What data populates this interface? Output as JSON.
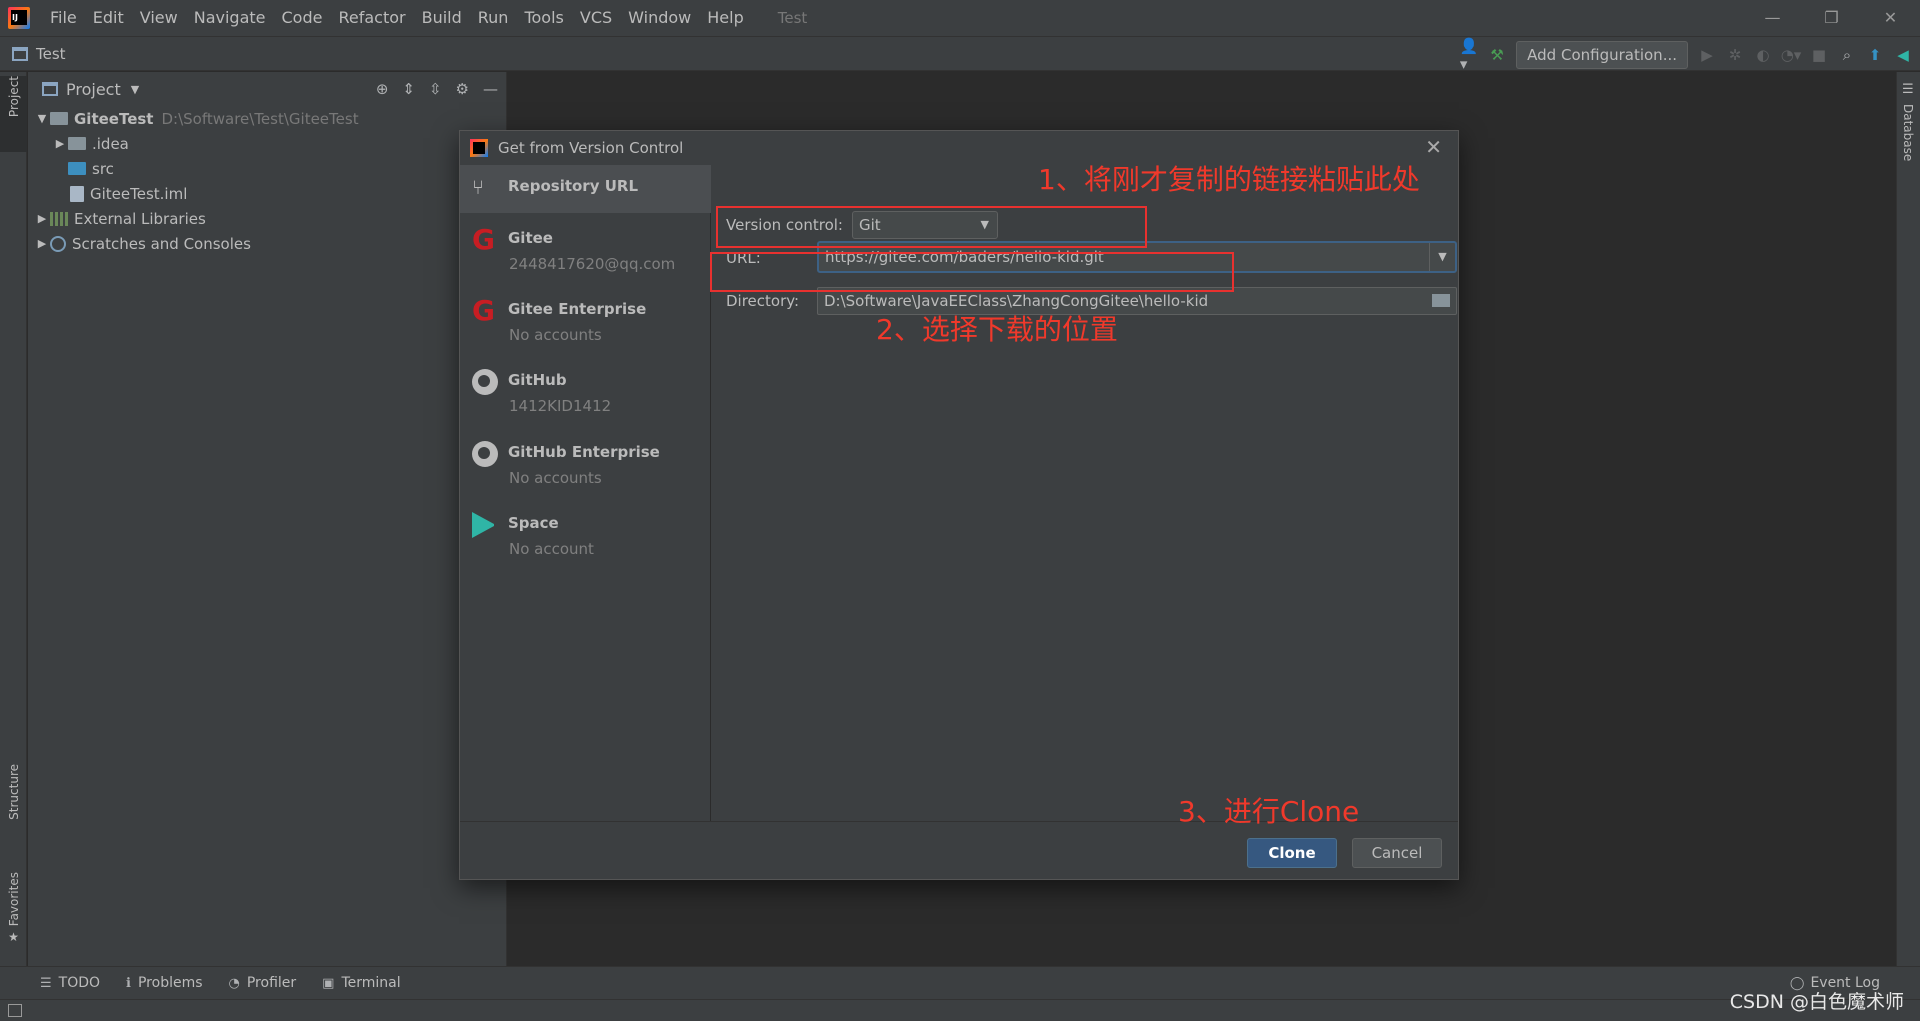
{
  "menubar": {
    "items": [
      "File",
      "Edit",
      "View",
      "Navigate",
      "Code",
      "Refactor",
      "Build",
      "Run",
      "Tools",
      "VCS",
      "Window",
      "Help"
    ],
    "project_name": "Test"
  },
  "navbar": {
    "title": "Test",
    "add_configuration": "Add Configuration..."
  },
  "left_strip": {
    "project_tab": "Project",
    "structure_tab": "Structure",
    "favorites_tab": "Favorites"
  },
  "right_strip": {
    "database_tab": "Database"
  },
  "project_panel": {
    "title": "Project",
    "tree": {
      "root_name": "GiteeTest",
      "root_path": "D:\\Software\\Test\\GiteeTest",
      "idea": ".idea",
      "src": "src",
      "iml": "GiteeTest.iml",
      "external": "External Libraries",
      "scratches": "Scratches and Consoles"
    }
  },
  "dialog": {
    "title": "Get from Version Control",
    "accounts": [
      {
        "name": "Repository URL",
        "sub": ""
      },
      {
        "name": "Gitee",
        "sub": "2448417620@qq.com"
      },
      {
        "name": "Gitee Enterprise",
        "sub": "No accounts"
      },
      {
        "name": "GitHub",
        "sub": "1412KID1412"
      },
      {
        "name": "GitHub Enterprise",
        "sub": "No accounts"
      },
      {
        "name": "Space",
        "sub": "No account"
      }
    ],
    "version_control_label": "Version control:",
    "version_control_value": "Git",
    "url_label": "URL:",
    "url_value": "https://gitee.com/baders/hello-kid.git",
    "directory_label": "Directory:",
    "directory_value": "D:\\Software\\JavaEEClass\\ZhangCongGitee\\hello-kid",
    "clone_button": "Clone",
    "cancel_button": "Cancel"
  },
  "annotations": {
    "step1": "1、将刚才复制的链接粘贴此处",
    "step2": "2、选择下载的位置",
    "step3": "3、进行Clone"
  },
  "bottom_tools": {
    "todo": "TODO",
    "problems": "Problems",
    "profiler": "Profiler",
    "terminal": "Terminal",
    "event_log": "Event Log"
  },
  "watermark": "CSDN @白色魔术师",
  "colors": {
    "annotation_red": "#e8312f",
    "clone_blue": "#365880",
    "gitee_red": "#c71d23"
  }
}
